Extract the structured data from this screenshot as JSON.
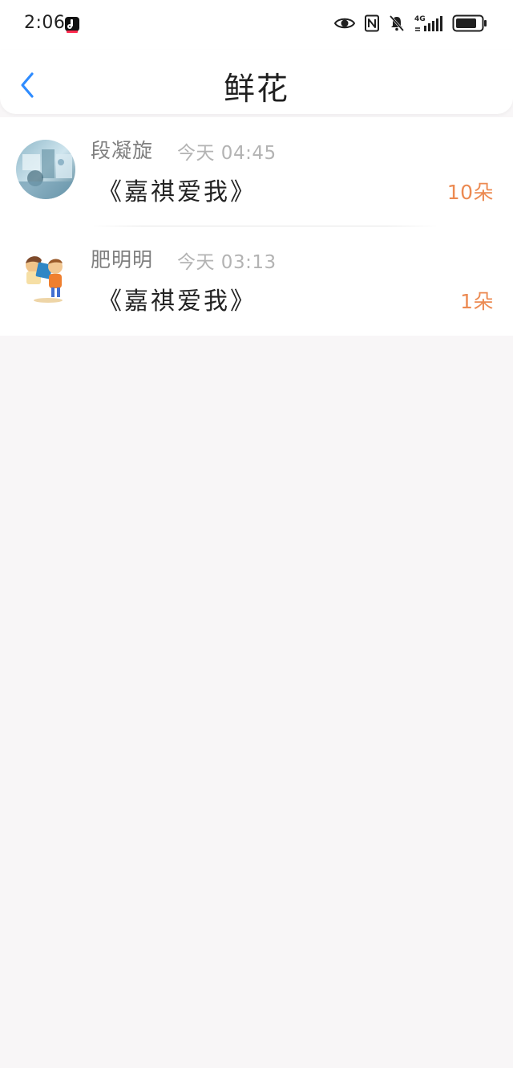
{
  "status_bar": {
    "time": "2:06",
    "network": "4G"
  },
  "header": {
    "title": "鲜花"
  },
  "items": [
    {
      "name": "段凝旋",
      "time": "今天 04:45",
      "gift": "《嘉祺爱我》",
      "count": "10朵"
    },
    {
      "name": "肥明明",
      "time": "今天 03:13",
      "gift": "《嘉祺爱我》",
      "count": "1朵"
    }
  ],
  "colors": {
    "accent": "#2f8cff",
    "count": "#ec8a52",
    "background": "#f8f6f7"
  }
}
